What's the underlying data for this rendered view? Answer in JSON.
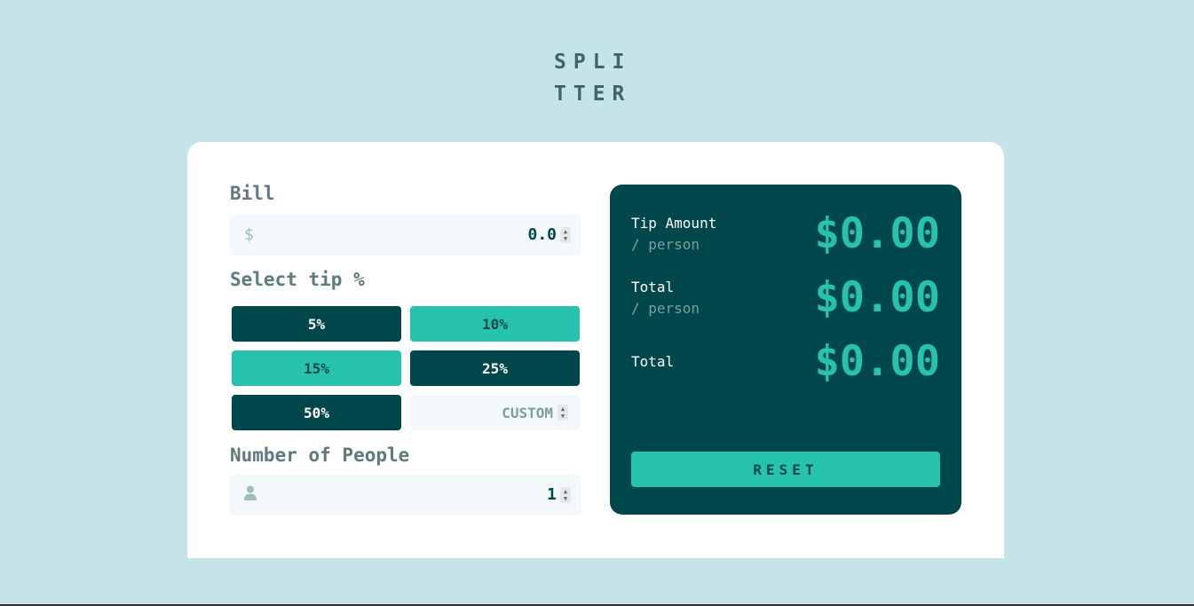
{
  "logo": {
    "line1": "SPLI",
    "line2": "TTER"
  },
  "bill": {
    "label": "Bill",
    "icon": "dollar-icon",
    "icon_glyph": "$",
    "value": "0.0"
  },
  "tip": {
    "label": "Select tip %",
    "options": [
      "5%",
      "10%",
      "15%",
      "25%",
      "50%"
    ],
    "custom_placeholder": "CUSTOM"
  },
  "people": {
    "label": "Number of People",
    "icon": "person-icon",
    "value": "1"
  },
  "results": {
    "tip_amount_label": "Tip Amount",
    "tip_amount_sub": "/ person",
    "tip_amount_value": "$0.00",
    "total_pp_label": "Total",
    "total_pp_sub": "/ person",
    "total_pp_value": "$0.00",
    "total_label": "Total",
    "total_value": "$0.00",
    "reset_label": "RESET"
  },
  "colors": {
    "background": "#c5e4e7",
    "dark": "#00474b",
    "accent": "#26c2ae",
    "muted": "#5e7a7d"
  }
}
